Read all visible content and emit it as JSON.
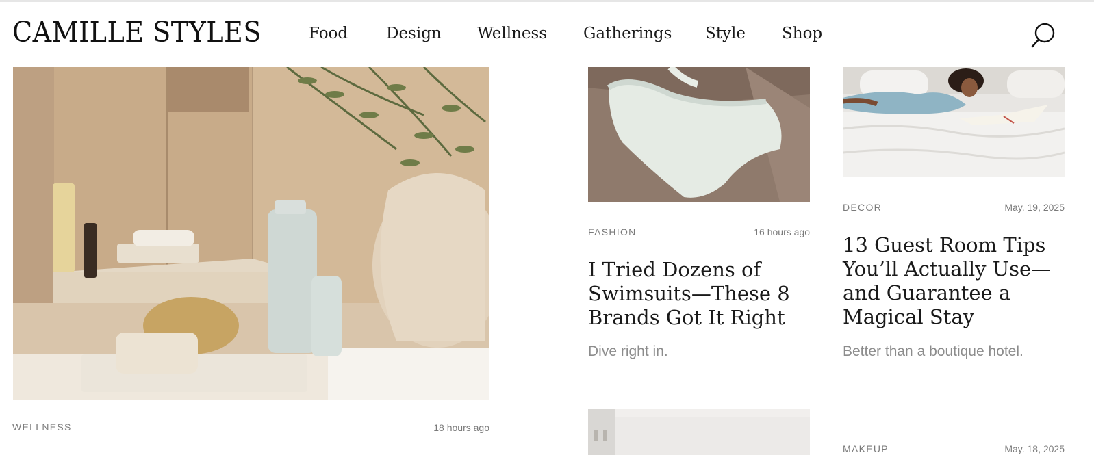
{
  "site": {
    "logo": "CAMILLE STYLES"
  },
  "nav": {
    "items": [
      "Food",
      "Design",
      "Wellness",
      "Gatherings",
      "Style",
      "Shop"
    ]
  },
  "icons": {
    "search": "search-icon"
  },
  "featured": {
    "category": "WELLNESS",
    "date": "18 hours ago"
  },
  "articles": [
    {
      "category": "FASHION",
      "date": "16 hours ago",
      "title": "I Tried Dozens of Swimsuits—These 8 Brands Got It Right",
      "dek": "Dive right in."
    },
    {
      "category": "DECOR",
      "date": "May. 19, 2025",
      "title": "13 Guest Room Tips You’ll Actually Use—and Guarantee a Magical Stay",
      "dek": "Better than a boutique hotel."
    },
    {
      "category": "MAKEUP",
      "date": "May. 18, 2025"
    }
  ],
  "colors": {
    "text": "#1a1a1a",
    "muted": "#7a7a7a",
    "dek": "#8c8c8c",
    "background": "#ffffff"
  }
}
